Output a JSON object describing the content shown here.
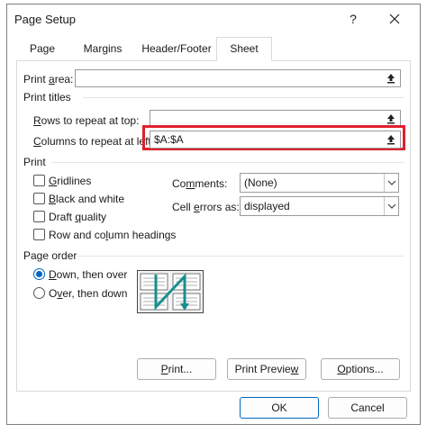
{
  "window": {
    "title": "Page Setup",
    "help_glyph": "?"
  },
  "tabs": [
    {
      "label": "Page",
      "active": false
    },
    {
      "label": "Margins",
      "active": false
    },
    {
      "label": "Header/Footer",
      "active": false
    },
    {
      "label": "Sheet",
      "active": true
    }
  ],
  "print_area": {
    "label_pre": "Print ",
    "label_u": "a",
    "label_post": "rea:",
    "value": ""
  },
  "print_titles": {
    "section_label": "Print titles",
    "rows": {
      "label_u": "R",
      "label_post": "ows to repeat at top:",
      "value": ""
    },
    "columns": {
      "label_u": "C",
      "label_post": "olumns to repeat at left:",
      "value": "$A:$A"
    }
  },
  "print": {
    "section_label": "Print",
    "gridlines": {
      "label_u": "G",
      "label_post": "ridlines",
      "checked": false
    },
    "black_white": {
      "label_u": "B",
      "label_post": "lack and white",
      "checked": false
    },
    "draft": {
      "label_pre": "Draft ",
      "label_u": "q",
      "label_post": "uality",
      "checked": false
    },
    "headings": {
      "label_pre": "Row and co",
      "label_u": "l",
      "label_post": "umn headings",
      "checked": false
    },
    "comments": {
      "label_pre": "Co",
      "label_u": "m",
      "label_post": "ments:",
      "value": "(None)"
    },
    "cell_errors": {
      "label_pre": "Cell ",
      "label_u": "e",
      "label_post": "rrors as:",
      "value": "displayed"
    }
  },
  "page_order": {
    "section_label": "Page order",
    "down_then_over": {
      "label_u": "D",
      "label_post": "own, then over",
      "selected": true
    },
    "over_then_down": {
      "label_pre": "O",
      "label_u": "v",
      "label_post": "er, then down",
      "selected": false
    }
  },
  "buttons": {
    "print": {
      "label_u": "P",
      "label_post": "rint..."
    },
    "print_preview": {
      "label_pre": "Print Previe",
      "label_u": "w",
      "label_post": ""
    },
    "options": {
      "label_u": "O",
      "label_post": "ptions..."
    },
    "ok": "OK",
    "cancel": "Cancel"
  },
  "colors": {
    "highlight_border": "#e0202c",
    "accent": "#0067c0",
    "preview_arrow": "#1a8f8f"
  },
  "icons": [
    "close-icon",
    "collapse-dialog-icon",
    "chevron-down-icon"
  ]
}
